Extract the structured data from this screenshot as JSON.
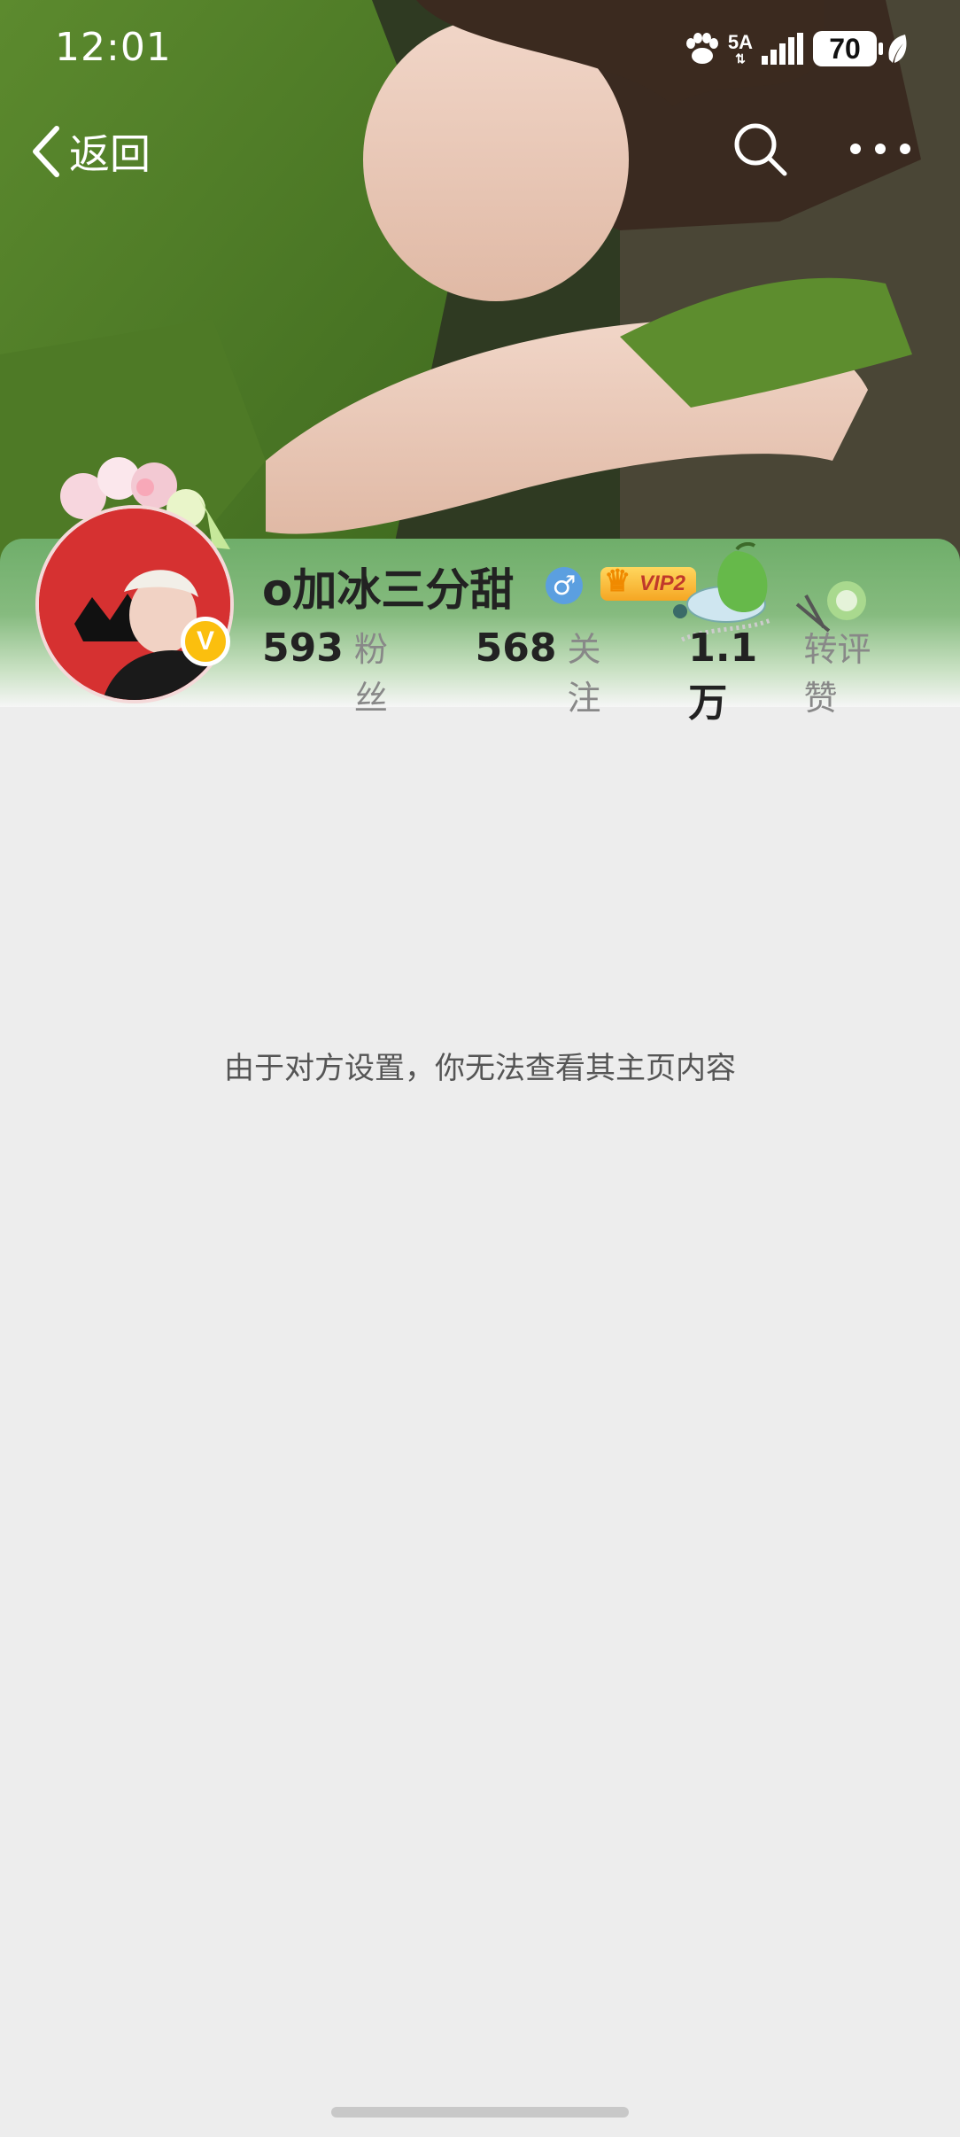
{
  "status_bar": {
    "time": "12:01",
    "network": "5A",
    "battery": "70"
  },
  "nav": {
    "back_label": "返回",
    "icons": [
      "chevron-left-icon",
      "search-icon",
      "more-icon"
    ]
  },
  "profile": {
    "username": "o加冰三分甜",
    "gender_symbol": "♂",
    "vip_label": "VIP2",
    "verified_symbol": "V",
    "stats": [
      {
        "value": "593",
        "label": "粉丝"
      },
      {
        "value": "568",
        "label": "关注"
      },
      {
        "value": "1.1万",
        "label": "转评赞"
      }
    ]
  },
  "content": {
    "notice": "由于对方设置，你无法查看其主页内容"
  },
  "colors": {
    "header_green": "#6fae6a",
    "background": "#ededed",
    "verify_badge": "#fbbf0e",
    "gender_blue": "#5b9fe0"
  }
}
